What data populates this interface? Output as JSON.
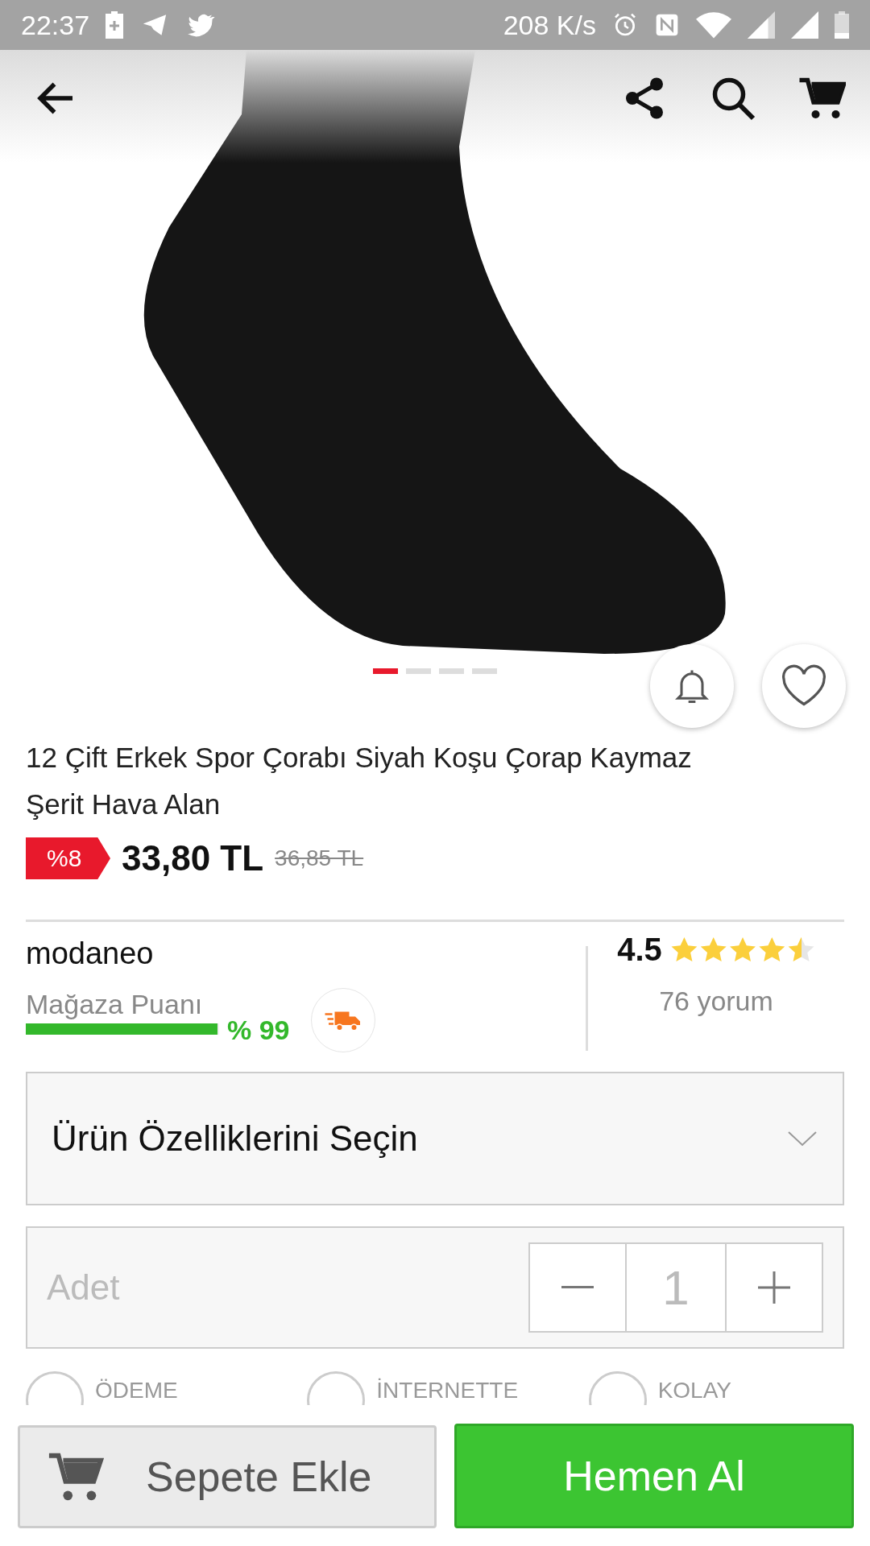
{
  "status_bar": {
    "time": "22:37",
    "speed": "208 K/s"
  },
  "carousel": {
    "dots": [
      {
        "selected": true
      },
      {
        "selected": false
      },
      {
        "selected": false
      },
      {
        "selected": false
      }
    ]
  },
  "product": {
    "title": "12 Çift Erkek Spor Çorabı Siyah Koşu Çorap Kaymaz Şerit Hava Alan",
    "discount": "%8",
    "price": "33,80 TL",
    "old_price": "36,85 TL"
  },
  "seller": {
    "name": "modaneo",
    "score_label": "Mağaza Puanı",
    "level": 0.99,
    "score": "% 99",
    "rating": "4.5",
    "stars": 4.5,
    "reviews": "76 yorum"
  },
  "options": {
    "label": "Ürün Özelliklerini Seçin"
  },
  "quantity": {
    "label": "Adet",
    "value": "1"
  },
  "features": [
    "ÖDEME",
    "İNTERNETTE",
    "KOLAY"
  ],
  "buttons": {
    "add_to_cart": "Sepete Ekle",
    "buy_now": "Hemen Al"
  }
}
